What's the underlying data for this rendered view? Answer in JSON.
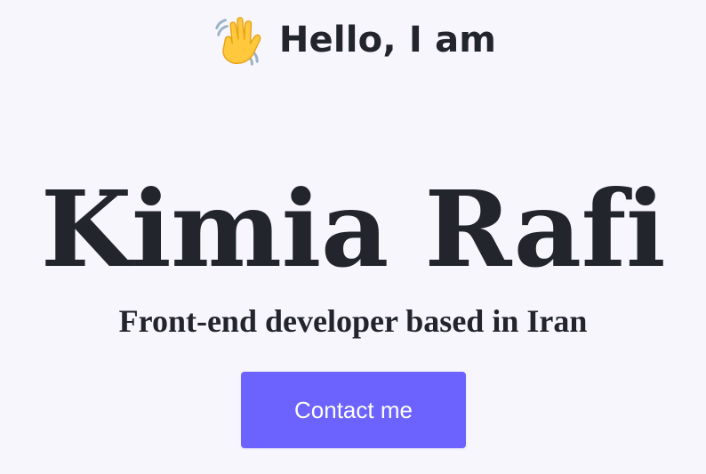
{
  "hero": {
    "greeting": {
      "icon": "waving-hand-icon",
      "text": "Hello, I am"
    },
    "name": "Kimia Rafi",
    "subtitle": "Front-end developer based in Iran",
    "contact_button": {
      "label": "Contact me",
      "color": "#6c63ff"
    }
  },
  "theme": {
    "background": "#f7f6fc",
    "text": "#22252b"
  }
}
